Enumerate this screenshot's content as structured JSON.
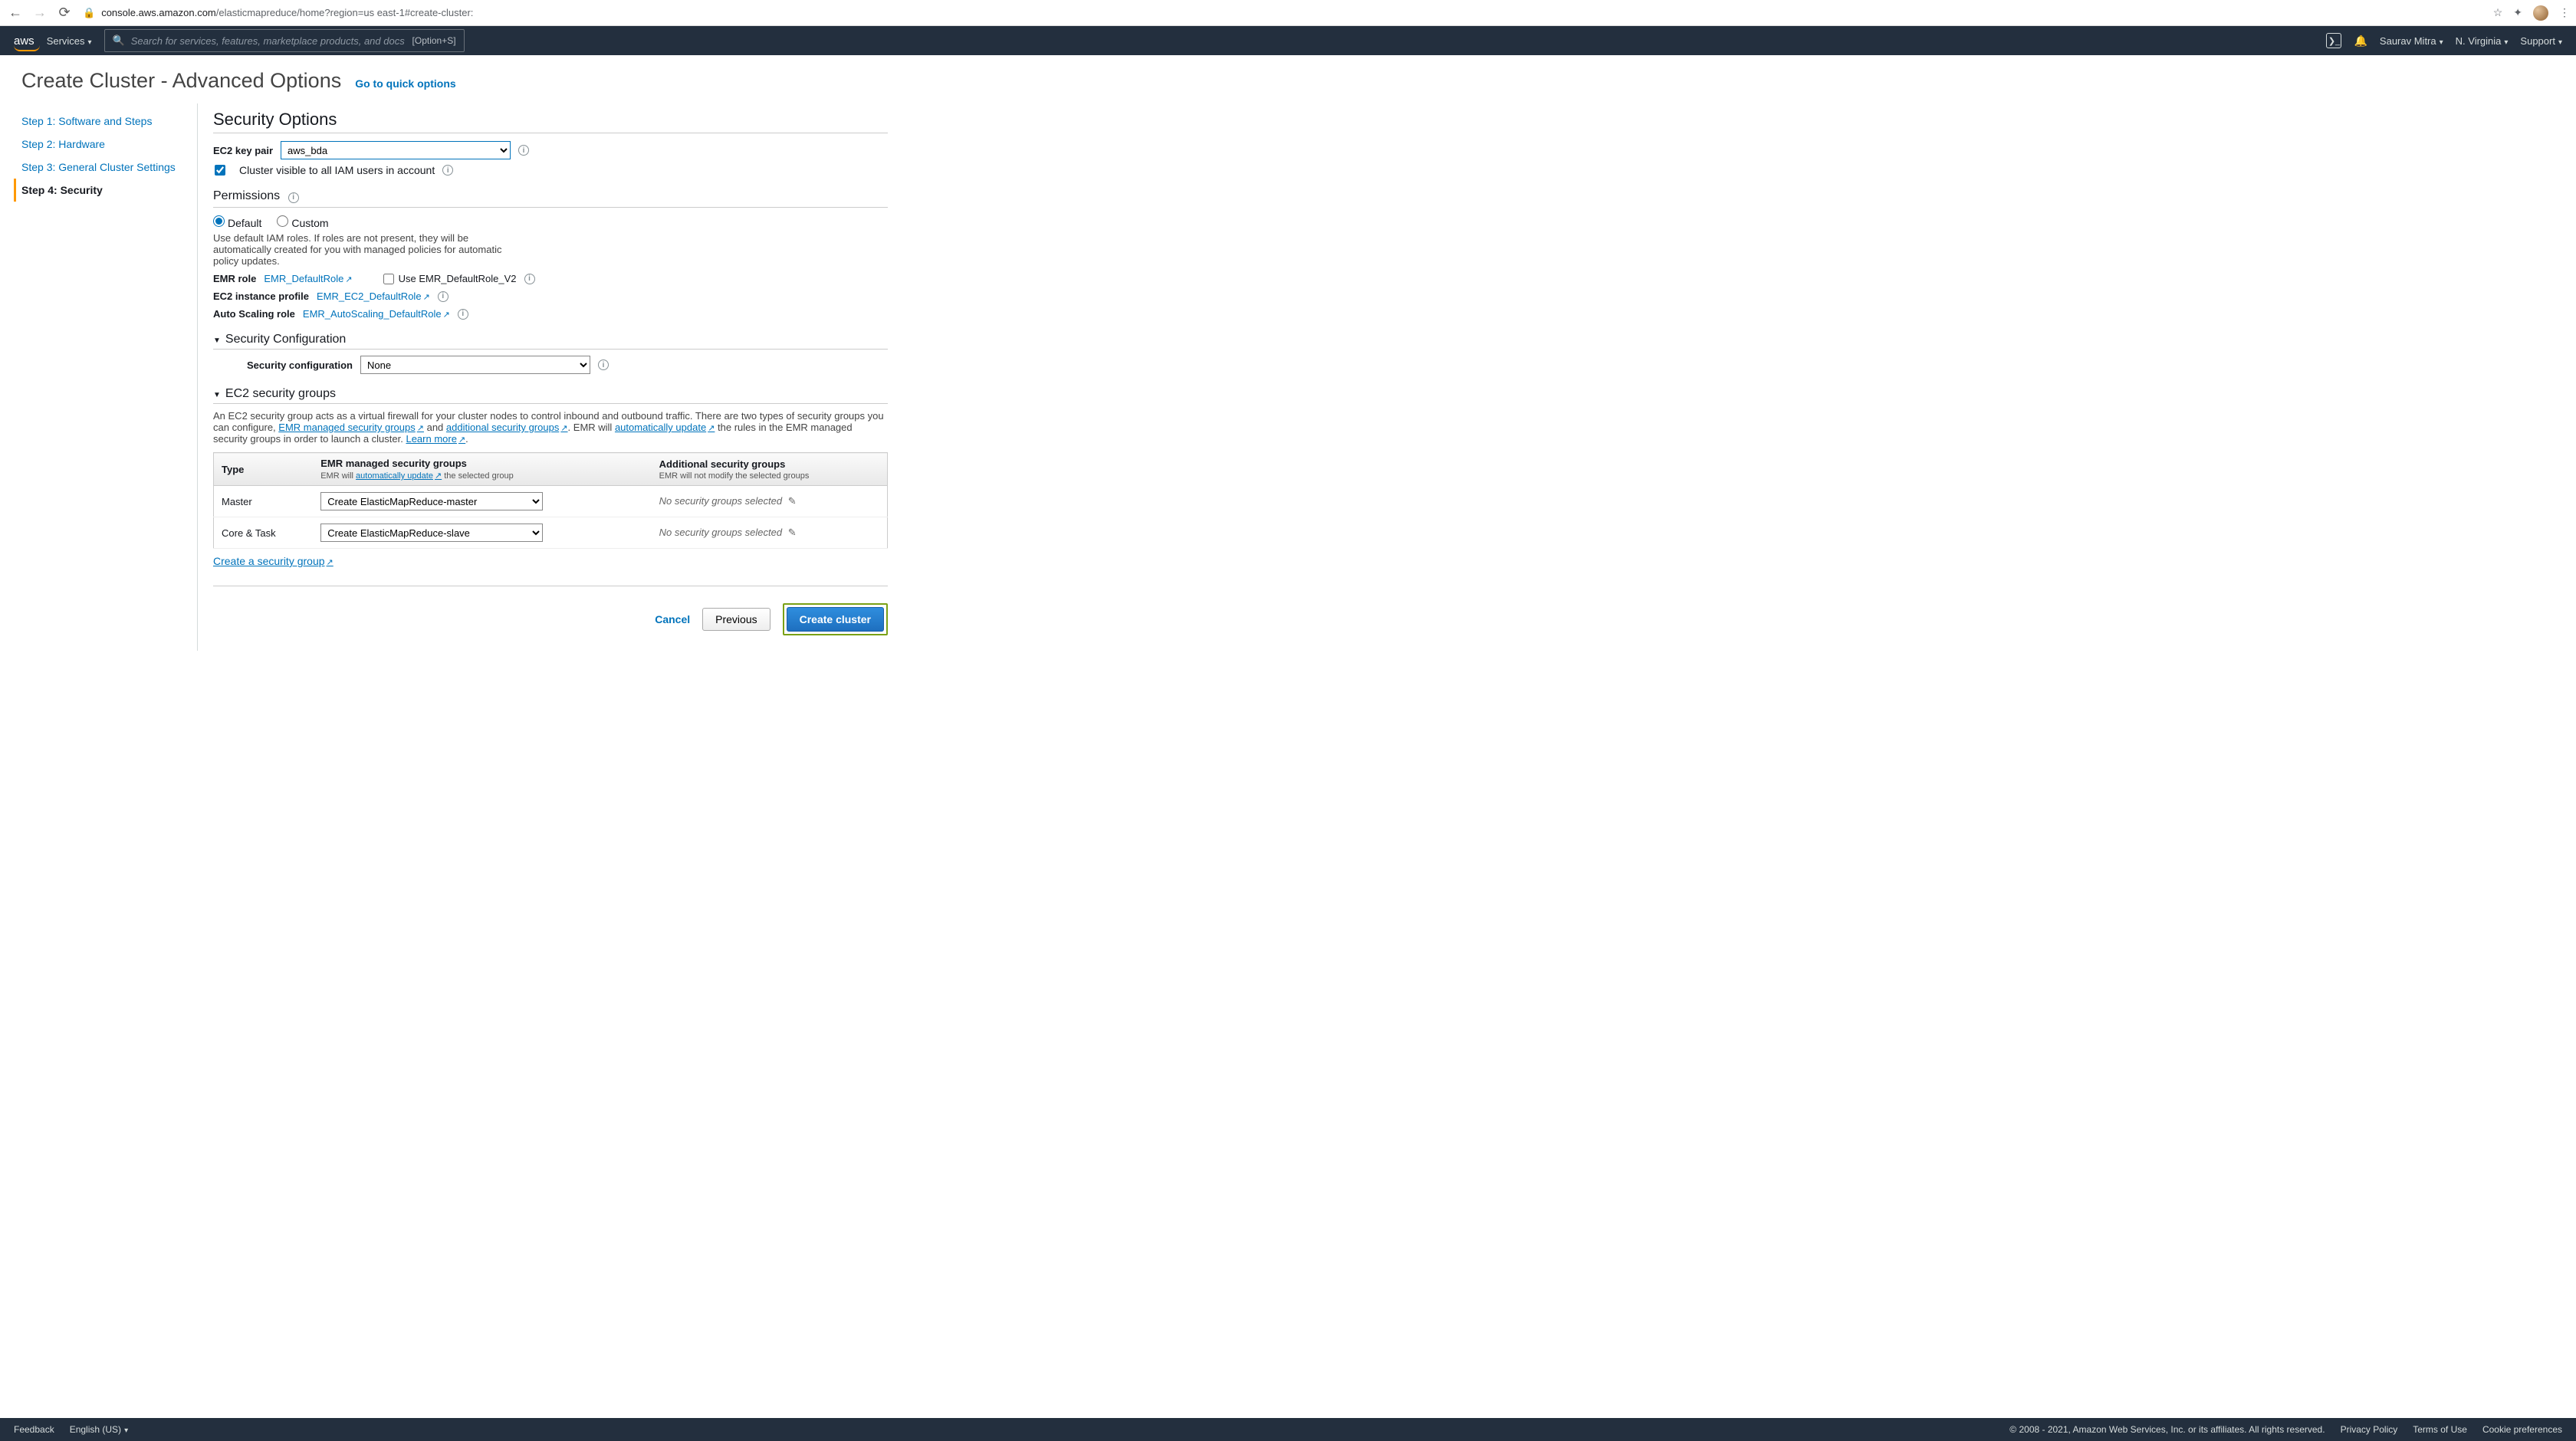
{
  "browser": {
    "url_host": "console.aws.amazon.com",
    "url_path": "/elasticmapreduce/home?region=us east-1#create-cluster:"
  },
  "nav": {
    "services": "Services",
    "search_placeholder": "Search for services, features, marketplace products, and docs",
    "search_kbd": "[Option+S]",
    "user": "Saurav Mitra",
    "region": "N. Virginia",
    "support": "Support"
  },
  "header": {
    "title": "Create Cluster - Advanced Options",
    "quick_link": "Go to quick options"
  },
  "steps": [
    "Step 1: Software and Steps",
    "Step 2: Hardware",
    "Step 3: General Cluster Settings",
    "Step 4: Security"
  ],
  "security": {
    "title": "Security Options",
    "ec2_key_lbl": "EC2 key pair",
    "ec2_key_value": "aws_bda",
    "visible_lbl": "Cluster visible to all IAM users in account",
    "perm_heading": "Permissions",
    "perm_opt_default": "Default",
    "perm_opt_custom": "Custom",
    "perm_desc": "Use default IAM roles. If roles are not present, they will be automatically created for you with managed policies for automatic policy updates.",
    "emr_role_lbl": "EMR role",
    "emr_role_val": "EMR_DefaultRole",
    "emr_role_v2": "Use EMR_DefaultRole_V2",
    "ec2_profile_lbl": "EC2 instance profile",
    "ec2_profile_val": "EMR_EC2_DefaultRole",
    "autoscale_lbl": "Auto Scaling role",
    "autoscale_val": "EMR_AutoScaling_DefaultRole",
    "secconf_heading": "Security Configuration",
    "secconf_lbl": "Security configuration",
    "secconf_val": "None",
    "sg_heading": "EC2 security groups",
    "sg_desc1": "An EC2 security group acts as a virtual firewall for your cluster nodes to control inbound and outbound traffic. There are two types of security groups you can configure, ",
    "sg_link_managed": "EMR managed security groups",
    "sg_desc_and": " and ",
    "sg_link_additional": "additional security groups",
    "sg_desc2": ". EMR will ",
    "sg_link_auto": "automatically update",
    "sg_desc3": " the rules in the EMR managed security groups in order to launch a cluster. ",
    "sg_learn": "Learn more",
    "table": {
      "h_type": "Type",
      "h_managed": "EMR managed security groups",
      "h_managed_sub_pre": "EMR will ",
      "h_managed_sub_link": "automatically update",
      "h_managed_sub_post": " the selected group",
      "h_additional": "Additional security groups",
      "h_additional_sub": "EMR will not modify the selected groups",
      "r1_type": "Master",
      "r1_sel": "Create ElasticMapReduce-master",
      "r1_add": "No security groups selected",
      "r2_type": "Core & Task",
      "r2_sel": "Create ElasticMapReduce-slave",
      "r2_add": "No security groups selected"
    },
    "create_sg_link": "Create a security group"
  },
  "actions": {
    "cancel": "Cancel",
    "previous": "Previous",
    "create": "Create cluster"
  },
  "footer": {
    "feedback": "Feedback",
    "lang": "English (US)",
    "legal": "© 2008 - 2021, Amazon Web Services, Inc. or its affiliates. All rights reserved.",
    "privacy": "Privacy Policy",
    "terms": "Terms of Use",
    "cookies": "Cookie preferences"
  }
}
